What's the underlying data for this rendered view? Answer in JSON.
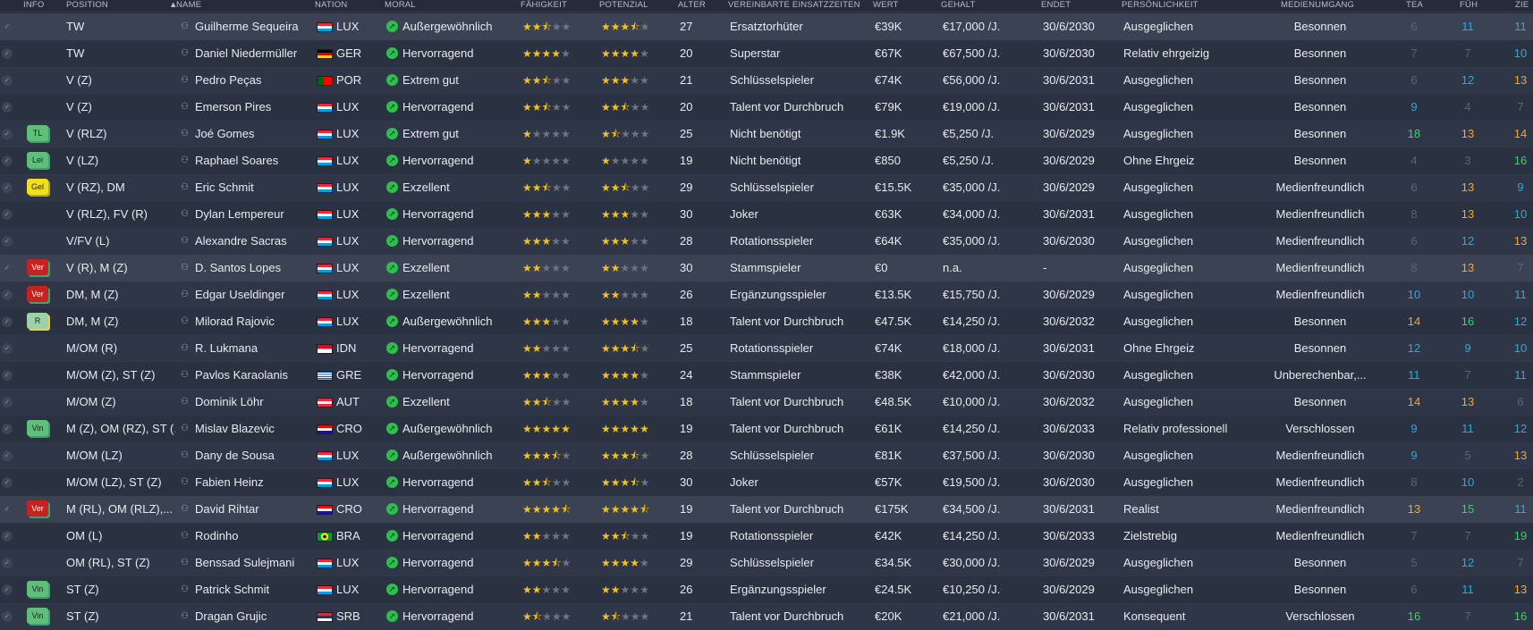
{
  "headers": {
    "info": "INFO",
    "position": "POSITION",
    "name": "NAME",
    "nation": "NATION",
    "moral": "MORAL",
    "ability": "FÄHIGKEIT",
    "potential": "POTENZIAL",
    "age": "ALTER",
    "playing_time": "VEREINBARTE EINSATZZEITEN",
    "value": "WERT",
    "wage": "GEHALT",
    "expires": "ENDET",
    "personality": "PERSÖNLICHKEIT",
    "media": "MEDIENUMGANG",
    "tea": "TEA",
    "fuh": "FÜH",
    "zie": "ZIE"
  },
  "sort_indicator": "▲",
  "colors": {
    "header_bg": "#252b38",
    "row_odd": "#2f3647",
    "row_even": "#2a3141",
    "row_selected": "#3a4253",
    "star": "#f4c21b",
    "attr_green": "#35d46a",
    "attr_blue": "#2fa8d8",
    "attr_orange": "#f2a72b",
    "morale_green": "#2fbe4e"
  },
  "players": [
    {
      "tag": "",
      "tag_color": "",
      "position": "TW",
      "name": "Guilherme Sequeira",
      "flag": "LUX",
      "nation": "LUX",
      "moral": "Außergewöhnlich",
      "ability": 2.5,
      "potential": 3.5,
      "age": "27",
      "playing_time": "Ersatztorhüter",
      "value": "€39K",
      "wage": "€17,000 /J.",
      "expires": "30/6/2030",
      "personality": "Ausgeglichen",
      "media": "Besonnen",
      "tea": "6",
      "fuh": "11",
      "zie": "11",
      "selected": true
    },
    {
      "tag": "",
      "tag_color": "",
      "position": "TW",
      "name": "Daniel Niedermüller",
      "flag": "GER",
      "nation": "GER",
      "moral": "Hervorragend",
      "ability": 4,
      "potential": 4,
      "age": "20",
      "playing_time": "Superstar",
      "value": "€67K",
      "wage": "€67,500 /J.",
      "expires": "30/6/2030",
      "personality": "Relativ ehrgeizig",
      "media": "Besonnen",
      "tea": "7",
      "fuh": "7",
      "zie": "10",
      "selected": false
    },
    {
      "tag": "",
      "tag_color": "",
      "position": "V (Z)",
      "name": "Pedro Peças",
      "flag": "POR",
      "nation": "POR",
      "moral": "Extrem gut",
      "ability": 2.5,
      "potential": 3,
      "age": "21",
      "playing_time": "Schlüsselspieler",
      "value": "€74K",
      "wage": "€56,000 /J.",
      "expires": "30/6/2031",
      "personality": "Ausgeglichen",
      "media": "Besonnen",
      "tea": "6",
      "fuh": "12",
      "zie": "13",
      "selected": false
    },
    {
      "tag": "",
      "tag_color": "",
      "position": "V (Z)",
      "name": "Emerson Pires",
      "flag": "LUX",
      "nation": "LUX",
      "moral": "Hervorragend",
      "ability": 2.5,
      "potential": 2.5,
      "age": "20",
      "playing_time": "Talent vor Durchbruch",
      "value": "€79K",
      "wage": "€19,000 /J.",
      "expires": "30/6/2031",
      "personality": "Ausgeglichen",
      "media": "Besonnen",
      "tea": "9",
      "fuh": "4",
      "zie": "7",
      "selected": false
    },
    {
      "tag": "TL",
      "tag_color": "green",
      "position": "V (RLZ)",
      "name": "Joé Gomes",
      "flag": "LUX",
      "nation": "LUX",
      "moral": "Extrem gut",
      "ability": 1,
      "potential": 1.5,
      "age": "25",
      "playing_time": "Nicht benötigt",
      "value": "€1.9K",
      "wage": "€5,250 /J.",
      "expires": "30/6/2029",
      "personality": "Ausgeglichen",
      "media": "Besonnen",
      "tea": "18",
      "fuh": "13",
      "zie": "14",
      "selected": false
    },
    {
      "tag": "Lei",
      "tag_color": "green",
      "position": "V (LZ)",
      "name": "Raphael Soares",
      "flag": "LUX",
      "nation": "LUX",
      "moral": "Hervorragend",
      "ability": 1,
      "potential": 1,
      "age": "19",
      "playing_time": "Nicht benötigt",
      "value": "€850",
      "wage": "€5,250 /J.",
      "expires": "30/6/2029",
      "personality": "Ohne Ehrgeiz",
      "media": "Besonnen",
      "tea": "4",
      "fuh": "3",
      "zie": "16",
      "selected": false
    },
    {
      "tag": "Gel",
      "tag_color": "yellow",
      "position": "V (RZ), DM",
      "name": "Eric Schmit",
      "flag": "LUX",
      "nation": "LUX",
      "moral": "Exzellent",
      "ability": 2.5,
      "potential": 2.5,
      "age": "29",
      "playing_time": "Schlüsselspieler",
      "value": "€15.5K",
      "wage": "€35,000 /J.",
      "expires": "30/6/2029",
      "personality": "Ausgeglichen",
      "media": "Medienfreundlich",
      "tea": "6",
      "fuh": "13",
      "zie": "9",
      "selected": false
    },
    {
      "tag": "",
      "tag_color": "",
      "position": "V (RLZ), FV (R)",
      "name": "Dylan Lempereur",
      "flag": "LUX",
      "nation": "LUX",
      "moral": "Hervorragend",
      "ability": 3,
      "potential": 3,
      "age": "30",
      "playing_time": "Joker",
      "value": "€63K",
      "wage": "€34,000 /J.",
      "expires": "30/6/2031",
      "personality": "Ausgeglichen",
      "media": "Medienfreundlich",
      "tea": "8",
      "fuh": "13",
      "zie": "10",
      "selected": false
    },
    {
      "tag": "",
      "tag_color": "",
      "position": "V/FV (L)",
      "name": "Alexandre Sacras",
      "flag": "LUX",
      "nation": "LUX",
      "moral": "Hervorragend",
      "ability": 3,
      "potential": 3,
      "age": "28",
      "playing_time": "Rotationsspieler",
      "value": "€64K",
      "wage": "€35,000 /J.",
      "expires": "30/6/2030",
      "personality": "Ausgeglichen",
      "media": "Medienfreundlich",
      "tea": "6",
      "fuh": "12",
      "zie": "13",
      "selected": false
    },
    {
      "tag": "Ver",
      "tag_color": "red",
      "position": "V (R), M (Z)",
      "name": "D. Santos Lopes",
      "flag": "LUX",
      "nation": "LUX",
      "moral": "Exzellent",
      "ability": 2,
      "potential": 2,
      "age": "30",
      "playing_time": "Stammspieler",
      "value": "€0",
      "wage": "n.a.",
      "expires": "-",
      "personality": "Ausgeglichen",
      "media": "Medienfreundlich",
      "tea": "8",
      "fuh": "13",
      "zie": "7",
      "selected": true
    },
    {
      "tag": "Ver",
      "tag_color": "red",
      "position": "DM, M (Z)",
      "name": "Edgar Useldinger",
      "flag": "LUX",
      "nation": "LUX",
      "moral": "Exzellent",
      "ability": 2,
      "potential": 2,
      "age": "26",
      "playing_time": "Ergänzungsspieler",
      "value": "€13.5K",
      "wage": "€15,750 /J.",
      "expires": "30/6/2029",
      "personality": "Ausgeglichen",
      "media": "Medienfreundlich",
      "tea": "10",
      "fuh": "10",
      "zie": "11",
      "selected": false
    },
    {
      "tag": "R",
      "tag_color": "light",
      "position": "DM, M (Z)",
      "name": "Milorad Rajovic",
      "flag": "LUX",
      "nation": "LUX",
      "moral": "Außergewöhnlich",
      "ability": 3,
      "potential": 4,
      "age": "18",
      "playing_time": "Talent vor Durchbruch",
      "value": "€47.5K",
      "wage": "€14,250 /J.",
      "expires": "30/6/2032",
      "personality": "Ausgeglichen",
      "media": "Besonnen",
      "tea": "14",
      "fuh": "16",
      "zie": "12",
      "selected": false
    },
    {
      "tag": "",
      "tag_color": "",
      "position": "M/OM (R)",
      "name": "R. Lukmana",
      "flag": "IDN",
      "nation": "IDN",
      "moral": "Hervorragend",
      "ability": 2,
      "potential": 3.5,
      "age": "25",
      "playing_time": "Rotationsspieler",
      "value": "€74K",
      "wage": "€18,000 /J.",
      "expires": "30/6/2031",
      "personality": "Ohne Ehrgeiz",
      "media": "Besonnen",
      "tea": "12",
      "fuh": "9",
      "zie": "10",
      "selected": false
    },
    {
      "tag": "",
      "tag_color": "",
      "position": "M/OM (Z), ST (Z)",
      "name": "Pavlos Karaolanis",
      "flag": "GRE",
      "nation": "GRE",
      "moral": "Hervorragend",
      "ability": 3,
      "potential": 4,
      "age": "24",
      "playing_time": "Stammspieler",
      "value": "€38K",
      "wage": "€42,000 /J.",
      "expires": "30/6/2030",
      "personality": "Ausgeglichen",
      "media": "Unberechenbar,...",
      "tea": "11",
      "fuh": "7",
      "zie": "11",
      "selected": false
    },
    {
      "tag": "",
      "tag_color": "",
      "position": "M/OM (Z)",
      "name": "Dominik Löhr",
      "flag": "AUT",
      "nation": "AUT",
      "moral": "Exzellent",
      "ability": 2.5,
      "potential": 4,
      "age": "18",
      "playing_time": "Talent vor Durchbruch",
      "value": "€48.5K",
      "wage": "€10,000 /J.",
      "expires": "30/6/2032",
      "personality": "Ausgeglichen",
      "media": "Besonnen",
      "tea": "14",
      "fuh": "13",
      "zie": "6",
      "selected": false
    },
    {
      "tag": "Vin",
      "tag_color": "green",
      "position": "M (Z), OM (RZ), ST (...",
      "name": "Mislav Blazevic",
      "flag": "CRO",
      "nation": "CRO",
      "moral": "Außergewöhnlich",
      "ability": 5,
      "potential": 5,
      "age": "19",
      "playing_time": "Talent vor Durchbruch",
      "value": "€61K",
      "wage": "€14,250 /J.",
      "expires": "30/6/2033",
      "personality": "Relativ professionell",
      "media": "Verschlossen",
      "tea": "9",
      "fuh": "11",
      "zie": "12",
      "selected": false
    },
    {
      "tag": "",
      "tag_color": "",
      "position": "M/OM (LZ)",
      "name": "Dany de Sousa",
      "flag": "LUX",
      "nation": "LUX",
      "moral": "Außergewöhnlich",
      "ability": 3.5,
      "potential": 3.5,
      "age": "28",
      "playing_time": "Schlüsselspieler",
      "value": "€81K",
      "wage": "€37,500 /J.",
      "expires": "30/6/2030",
      "personality": "Ausgeglichen",
      "media": "Medienfreundlich",
      "tea": "9",
      "fuh": "5",
      "zie": "13",
      "selected": false
    },
    {
      "tag": "",
      "tag_color": "",
      "position": "M/OM (LZ), ST (Z)",
      "name": "Fabien Heinz",
      "flag": "LUX",
      "nation": "LUX",
      "moral": "Hervorragend",
      "ability": 2.5,
      "potential": 3.5,
      "age": "30",
      "playing_time": "Joker",
      "value": "€57K",
      "wage": "€19,500 /J.",
      "expires": "30/6/2030",
      "personality": "Ausgeglichen",
      "media": "Medienfreundlich",
      "tea": "8",
      "fuh": "10",
      "zie": "2",
      "selected": false
    },
    {
      "tag": "Ver",
      "tag_color": "red",
      "position": "M (RL), OM (RLZ),...",
      "name": "David Rihtar",
      "flag": "CRO",
      "nation": "CRO",
      "moral": "Hervorragend",
      "ability": 4.5,
      "potential": 4.5,
      "age": "19",
      "playing_time": "Talent vor Durchbruch",
      "value": "€175K",
      "wage": "€34,500 /J.",
      "expires": "30/6/2031",
      "personality": "Realist",
      "media": "Medienfreundlich",
      "tea": "13",
      "fuh": "15",
      "zie": "11",
      "selected": true
    },
    {
      "tag": "",
      "tag_color": "",
      "position": "OM (L)",
      "name": "Rodinho",
      "flag": "BRA",
      "nation": "BRA",
      "moral": "Hervorragend",
      "ability": 2,
      "potential": 2.5,
      "age": "19",
      "playing_time": "Rotationsspieler",
      "value": "€42K",
      "wage": "€14,250 /J.",
      "expires": "30/6/2033",
      "personality": "Zielstrebig",
      "media": "Medienfreundlich",
      "tea": "7",
      "fuh": "7",
      "zie": "19",
      "selected": false
    },
    {
      "tag": "",
      "tag_color": "",
      "position": "OM (RL), ST (Z)",
      "name": "Benssad Sulejmani",
      "flag": "LUX",
      "nation": "LUX",
      "moral": "Hervorragend",
      "ability": 3.5,
      "potential": 4,
      "age": "29",
      "playing_time": "Schlüsselspieler",
      "value": "€34.5K",
      "wage": "€30,000 /J.",
      "expires": "30/6/2029",
      "personality": "Ausgeglichen",
      "media": "Besonnen",
      "tea": "5",
      "fuh": "12",
      "zie": "7",
      "selected": false
    },
    {
      "tag": "Vin",
      "tag_color": "green",
      "position": "ST (Z)",
      "name": "Patrick Schmit",
      "flag": "LUX",
      "nation": "LUX",
      "moral": "Hervorragend",
      "ability": 2,
      "potential": 2,
      "age": "26",
      "playing_time": "Ergänzungsspieler",
      "value": "€24.5K",
      "wage": "€10,250 /J.",
      "expires": "30/6/2029",
      "personality": "Ausgeglichen",
      "media": "Besonnen",
      "tea": "6",
      "fuh": "11",
      "zie": "13",
      "selected": false
    },
    {
      "tag": "Vin",
      "tag_color": "green",
      "position": "ST (Z)",
      "name": "Dragan Grujic",
      "flag": "SRB",
      "nation": "SRB",
      "moral": "Hervorragend",
      "ability": 1.5,
      "potential": 1.5,
      "age": "21",
      "playing_time": "Talent vor Durchbruch",
      "value": "€20K",
      "wage": "€21,000 /J.",
      "expires": "30/6/2031",
      "personality": "Konsequent",
      "media": "Verschlossen",
      "tea": "16",
      "fuh": "7",
      "zie": "16",
      "selected": false
    }
  ]
}
